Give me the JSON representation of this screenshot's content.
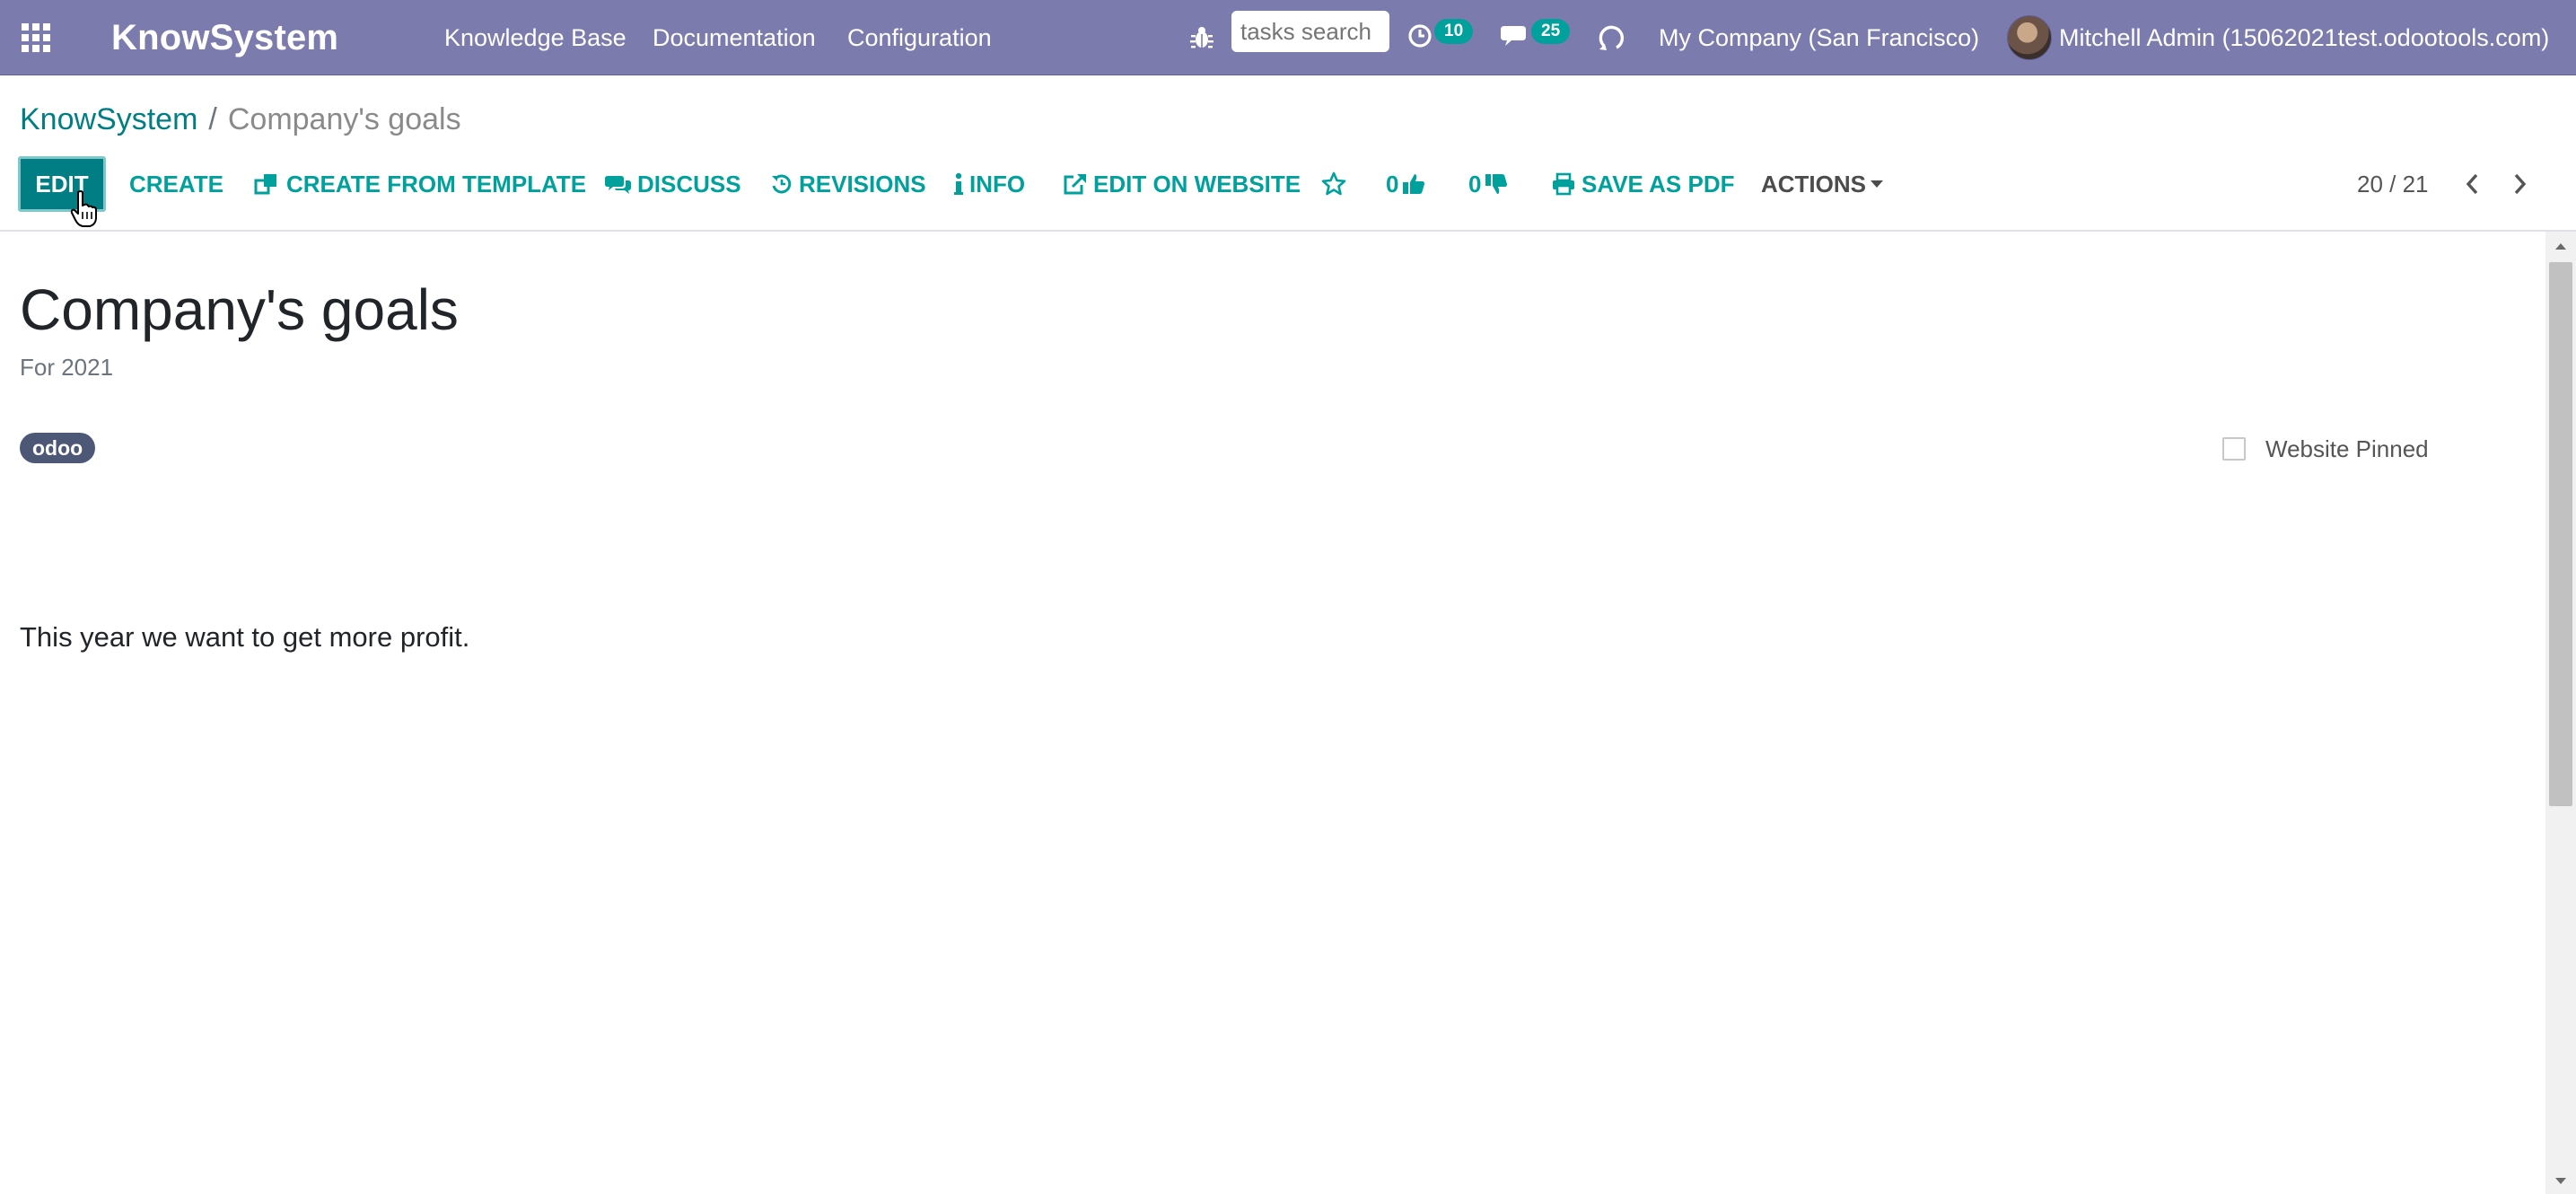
{
  "navbar": {
    "brand": "KnowSystem",
    "menu": [
      "Knowledge Base",
      "Documentation",
      "Configuration"
    ],
    "search_placeholder": "tasks search",
    "activity_count": "10",
    "messages_count": "25",
    "company": "My Company (San Francisco)",
    "user": "Mitchell Admin (15062021test.odootools.com)"
  },
  "breadcrumb": {
    "root": "KnowSystem",
    "separator": "/",
    "current": "Company's goals"
  },
  "toolbar": {
    "edit": "EDIT",
    "create": "CREATE",
    "create_from_template": "CREATE FROM TEMPLATE",
    "discuss": "DISCUSS",
    "revisions": "REVISIONS",
    "info": "INFO",
    "edit_on_website": "EDIT ON WEBSITE",
    "likes": "0",
    "dislikes": "0",
    "save_as_pdf": "SAVE AS PDF",
    "actions": "ACTIONS"
  },
  "pager": {
    "value": "20 / 21"
  },
  "article": {
    "title": "Company's goals",
    "subtitle": "For 2021",
    "tag": "odoo",
    "website_pinned_label": "Website Pinned",
    "website_pinned": false,
    "body": "This year we want to get more profit."
  },
  "colors": {
    "navbar": "#7c7bad",
    "accent": "#00a09d",
    "primary_button": "#017e84",
    "tag": "#4c5876"
  },
  "icons": [
    "apps-grid-icon",
    "bug-icon",
    "clock-icon",
    "chat-icon",
    "switch-icon",
    "clone-icon",
    "comments-icon",
    "history-icon",
    "info-icon",
    "external-link-icon",
    "star-icon",
    "thumbs-up-icon",
    "thumbs-down-icon",
    "print-icon",
    "caret-down-icon",
    "chevron-left-icon",
    "chevron-right-icon",
    "hand-cursor-icon"
  ]
}
